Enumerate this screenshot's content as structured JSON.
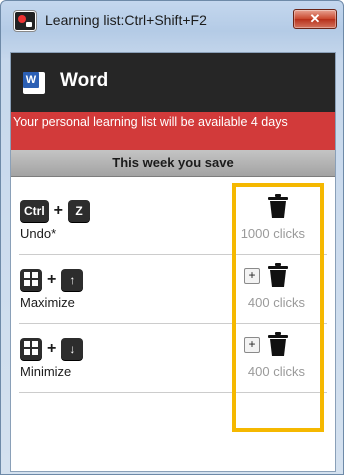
{
  "window": {
    "title": "Learning list:Ctrl+Shift+F2",
    "close_icon": "close-x-icon",
    "app_logo_icon": "app-logo-icon"
  },
  "app": {
    "icon": "word-app-icon",
    "icon_letter": "W",
    "name": "Word"
  },
  "notice": "Your personal learning list will be available 4 days",
  "save_header": "This week you save",
  "colors": {
    "header_bg": "#262626",
    "notice_bg": "#d23a3a",
    "highlight": "#f5b800"
  },
  "shortcuts": [
    {
      "keys": [
        "Ctrl",
        "Z"
      ],
      "plus": "+",
      "action": "Undo*",
      "clicks": "1000 clicks",
      "has_add": false
    },
    {
      "keys": [
        "windows-logo-icon",
        "arrow-up-icon"
      ],
      "plus": "+",
      "action": "Maximize",
      "clicks": "400 clicks",
      "has_add": true,
      "add_label": "+"
    },
    {
      "keys": [
        "windows-logo-icon",
        "arrow-down-icon"
      ],
      "plus": "+",
      "action": "Minimize",
      "clicks": "400 clicks",
      "has_add": true,
      "add_label": "+"
    }
  ]
}
